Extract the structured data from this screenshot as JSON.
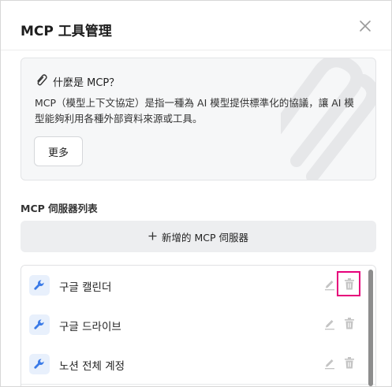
{
  "dialog": {
    "title": "MCP 工具管理",
    "close_icon": "close-icon"
  },
  "info": {
    "icon": "paperclip-icon",
    "title": "什麼是 MCP？",
    "description": "MCP（模型上下文協定）是指一種為 AI 模型提供標準化的協議，讓 AI 模型能夠利用各種外部資料來源或工具。",
    "more_label": "更多"
  },
  "servers": {
    "section_label": "MCP 伺服器列表",
    "add_label": "新增的 MCP 伺服器",
    "items": [
      {
        "name": "구글 캘린더"
      },
      {
        "name": "구글 드라이브"
      },
      {
        "name": "노션 전체 계정"
      }
    ]
  },
  "colors": {
    "accent": "#3b7be8",
    "highlight": "#e6007a",
    "panel_bg": "#f6f7f8",
    "button_bg": "#edeef0"
  }
}
